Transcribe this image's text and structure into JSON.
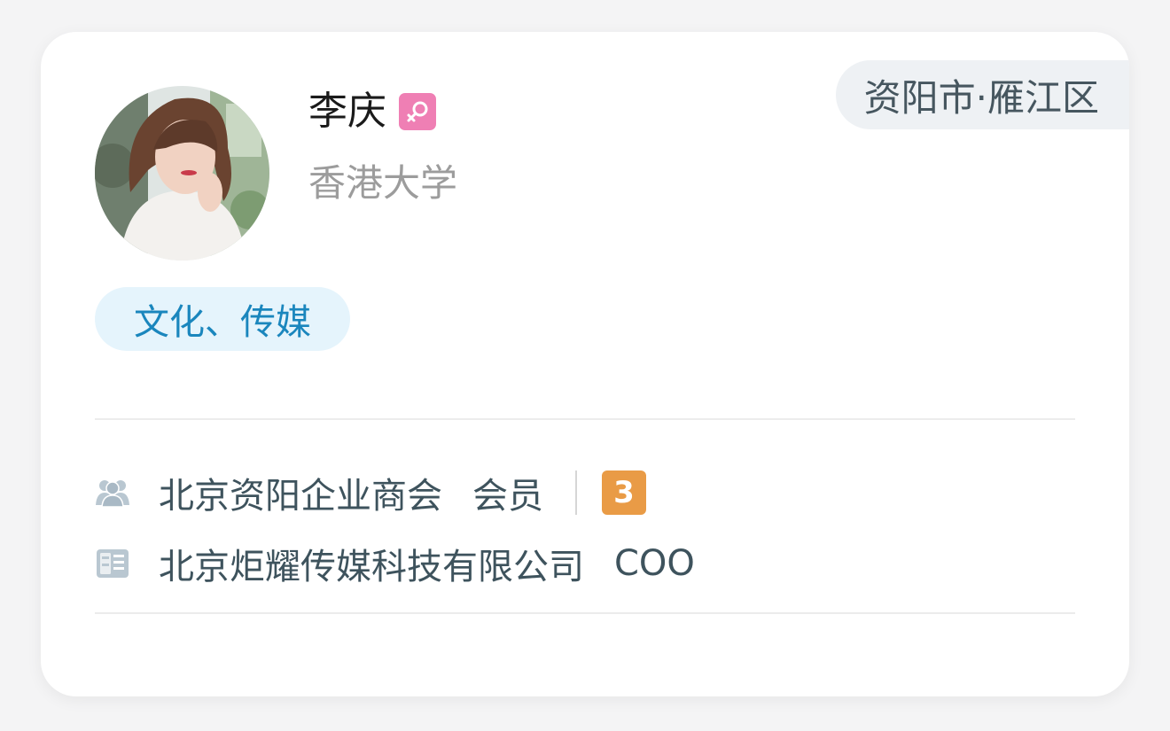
{
  "profile": {
    "name": "李庆",
    "gender": "female",
    "gender_icon": "female-icon",
    "school": "香港大学",
    "location": "资阳市·雁江区",
    "tag": "文化、传媒"
  },
  "membership": {
    "icon": "group-icon",
    "org": "北京资阳企业商会",
    "role": "会员",
    "count": "3"
  },
  "company": {
    "icon": "building-icon",
    "name": "北京炬耀传媒科技有限公司",
    "title": "COO"
  },
  "colors": {
    "female_pink": "#ef7fb4",
    "school_gray": "#9c9c9c",
    "location_bg": "#eef1f4",
    "location_text": "#46565f",
    "tag_bg": "#e5f4fc",
    "tag_text": "#1a86bd",
    "info_text": "#3e535d",
    "icon_gray": "#b9c7d1",
    "badge_orange": "#e99b46",
    "divider": "#ececec"
  }
}
